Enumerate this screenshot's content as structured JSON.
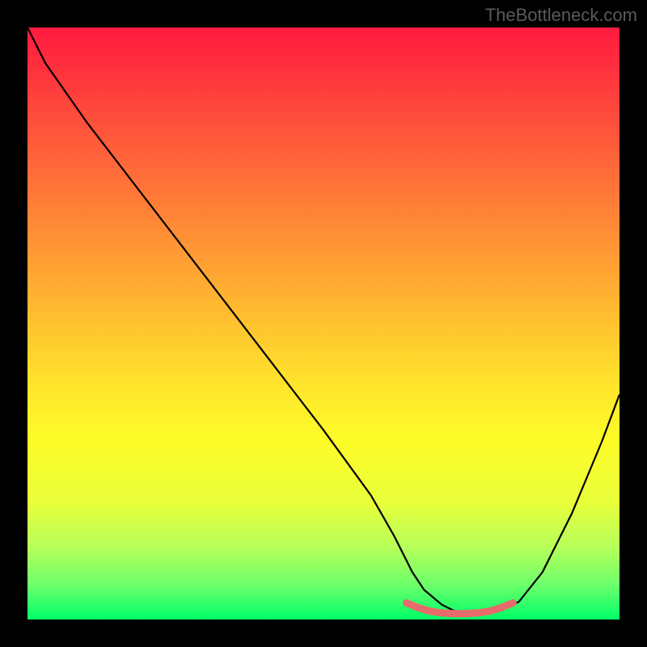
{
  "watermark": "TheBottleneck.com",
  "chart_data": {
    "type": "line",
    "title": "",
    "xlabel": "",
    "ylabel": "",
    "xlim": [
      0,
      100
    ],
    "ylim": [
      0,
      100
    ],
    "series": [
      {
        "name": "curve",
        "x": [
          0,
          3,
          10,
          20,
          30,
          40,
          50,
          58,
          62,
          65,
          67,
          70,
          72,
          74,
          76,
          78,
          80,
          83,
          87,
          92,
          97,
          100
        ],
        "values": [
          100,
          94,
          84,
          71,
          58,
          45,
          32,
          21,
          14,
          8,
          5,
          2.5,
          1.5,
          1,
          0.8,
          1,
          1.5,
          3,
          8,
          18,
          30,
          38
        ]
      }
    ],
    "highlight": {
      "name": "coral-band",
      "color": "#e96a6a",
      "x": [
        64,
        66,
        68,
        70,
        72,
        74,
        76,
        78,
        80,
        82
      ],
      "values": [
        2.8,
        2.0,
        1.4,
        1.1,
        1.0,
        1.0,
        1.1,
        1.4,
        2.0,
        2.8
      ]
    }
  }
}
